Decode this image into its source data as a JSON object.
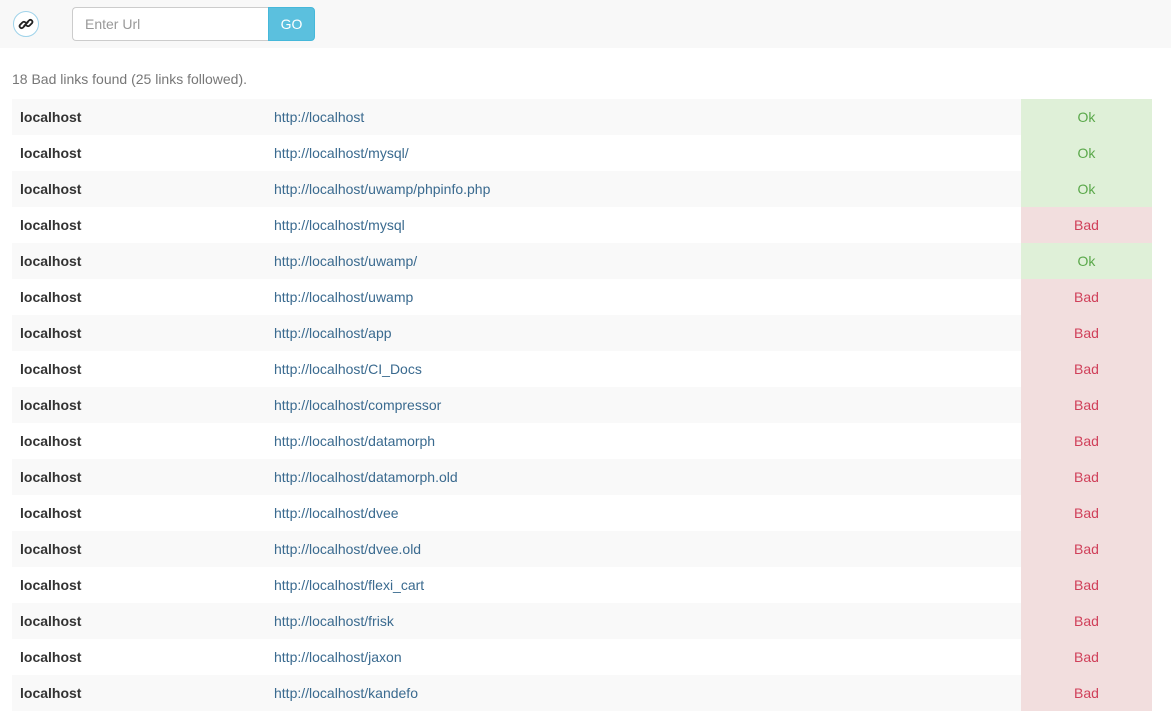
{
  "header": {
    "logo_icon": "link-icon",
    "url_placeholder": "Enter Url",
    "url_value": "",
    "go_label": "GO"
  },
  "summary": "18 Bad links found (25 links followed).",
  "colors": {
    "go_button": "#5bc0de",
    "ok_bg": "#dff0d8",
    "bad_bg": "#f2dede"
  },
  "rows": [
    {
      "host": "localhost",
      "url": "http://localhost",
      "status": "Ok"
    },
    {
      "host": "localhost",
      "url": "http://localhost/mysql/",
      "status": "Ok"
    },
    {
      "host": "localhost",
      "url": "http://localhost/uwamp/phpinfo.php",
      "status": "Ok"
    },
    {
      "host": "localhost",
      "url": "http://localhost/mysql",
      "status": "Bad"
    },
    {
      "host": "localhost",
      "url": "http://localhost/uwamp/",
      "status": "Ok"
    },
    {
      "host": "localhost",
      "url": "http://localhost/uwamp",
      "status": "Bad"
    },
    {
      "host": "localhost",
      "url": "http://localhost/app",
      "status": "Bad"
    },
    {
      "host": "localhost",
      "url": "http://localhost/CI_Docs",
      "status": "Bad"
    },
    {
      "host": "localhost",
      "url": "http://localhost/compressor",
      "status": "Bad"
    },
    {
      "host": "localhost",
      "url": "http://localhost/datamorph",
      "status": "Bad"
    },
    {
      "host": "localhost",
      "url": "http://localhost/datamorph.old",
      "status": "Bad"
    },
    {
      "host": "localhost",
      "url": "http://localhost/dvee",
      "status": "Bad"
    },
    {
      "host": "localhost",
      "url": "http://localhost/dvee.old",
      "status": "Bad"
    },
    {
      "host": "localhost",
      "url": "http://localhost/flexi_cart",
      "status": "Bad"
    },
    {
      "host": "localhost",
      "url": "http://localhost/frisk",
      "status": "Bad"
    },
    {
      "host": "localhost",
      "url": "http://localhost/jaxon",
      "status": "Bad"
    },
    {
      "host": "localhost",
      "url": "http://localhost/kandefo",
      "status": "Bad"
    }
  ]
}
